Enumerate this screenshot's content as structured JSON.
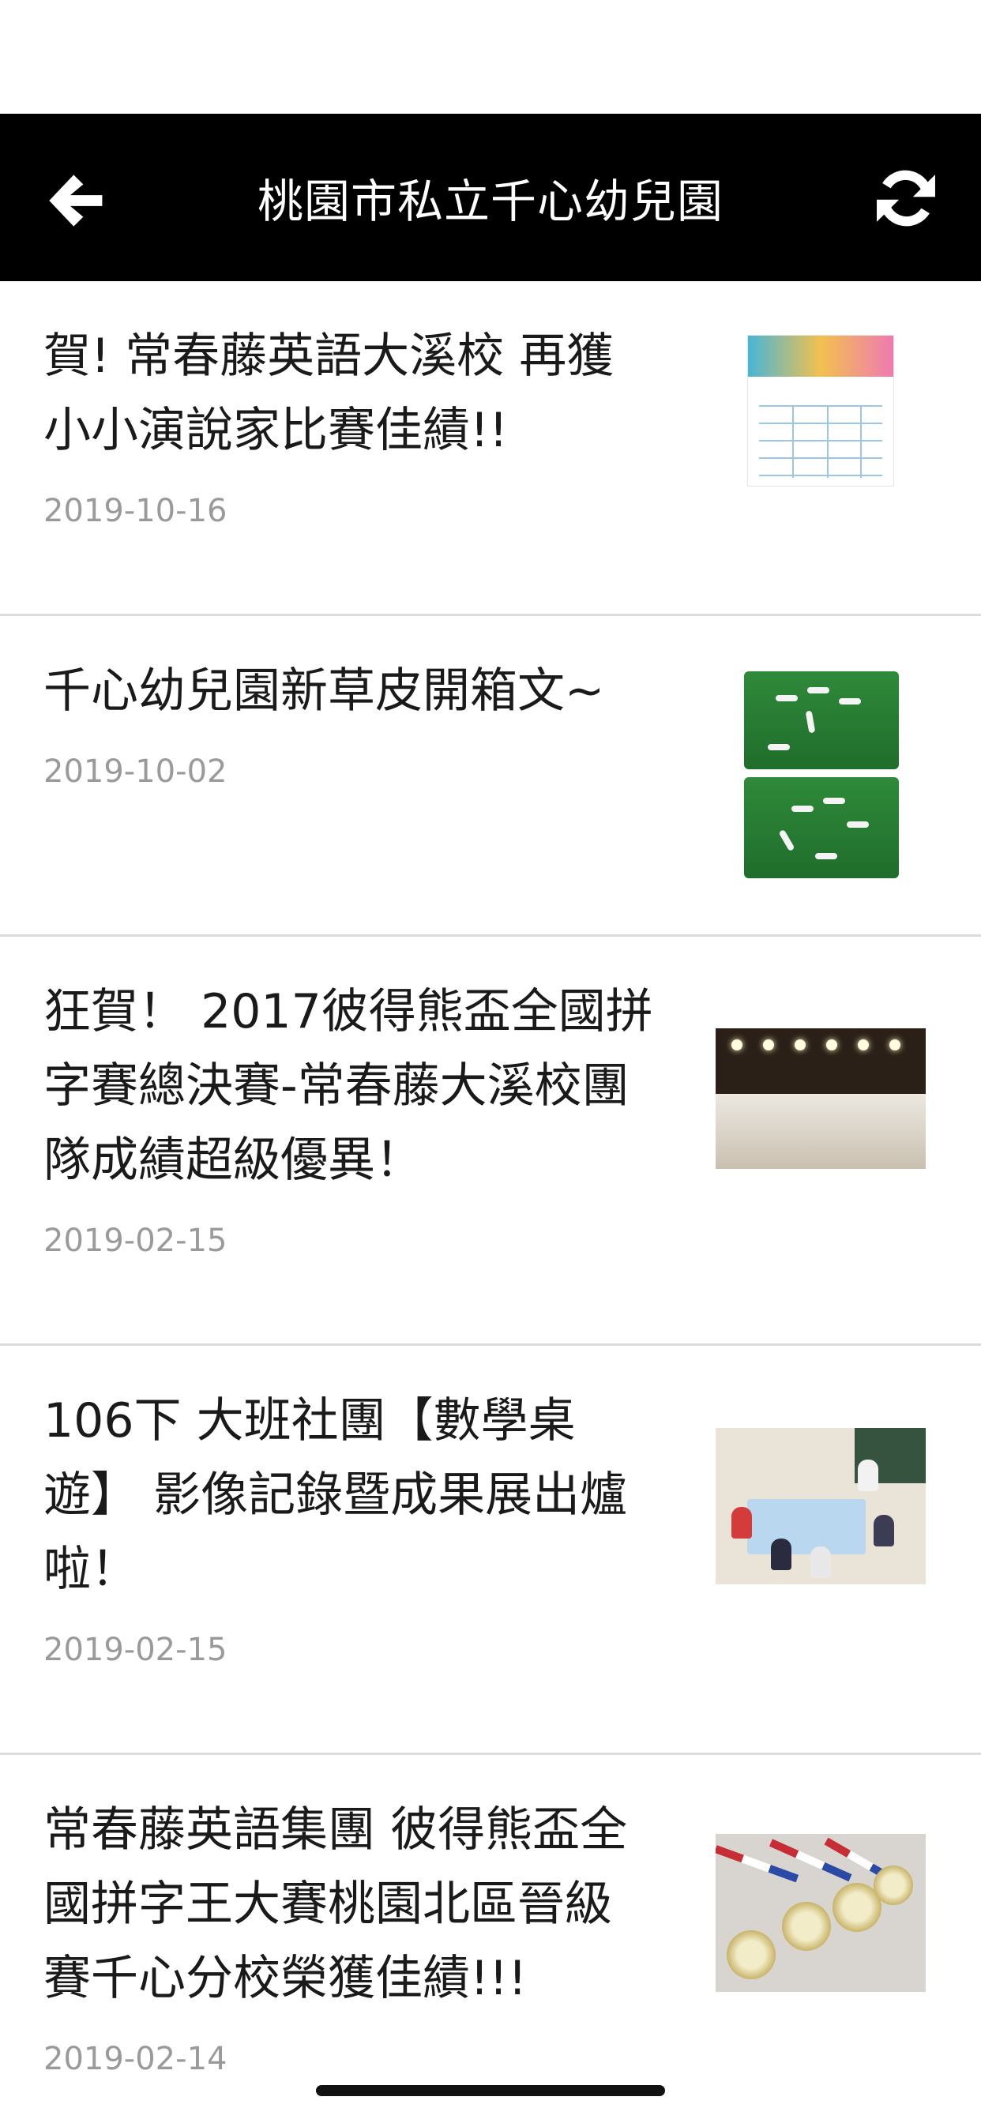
{
  "header": {
    "title": "桃園市私立千心幼兒園",
    "back_icon": "arrow-left-icon",
    "refresh_icon": "refresh-icon"
  },
  "articles": [
    {
      "lines": [
        "賀! 常春藤英語大溪校 再獲",
        "小小演說家比賽佳績!!"
      ],
      "date": "2019-10-16",
      "thumbnail": "award-table-poster"
    },
    {
      "lines": [
        "千心幼兒園新草皮開箱文~"
      ],
      "date": "2019-10-02",
      "thumbnail": "children-on-grass"
    },
    {
      "lines": [
        "狂賀！ 2017彼得熊盃全國拼",
        "字賽總決賽-常春藤大溪校團",
        "隊成績超級優異！"
      ],
      "date": "2019-02-15",
      "thumbnail": "stage-group-photo"
    },
    {
      "lines": [
        "106下 大班社團【數學桌",
        "遊】 影像記錄暨成果展出爐",
        "啦！"
      ],
      "date": "2019-02-15",
      "thumbnail": "classroom-board-game"
    },
    {
      "lines": [
        "常春藤英語集團 彼得熊盃全",
        "國拼字王大賽桃園北區晉級",
        "賽千心分校榮獲佳績!!!"
      ],
      "date": "2019-02-14",
      "thumbnail": "medals"
    }
  ]
}
